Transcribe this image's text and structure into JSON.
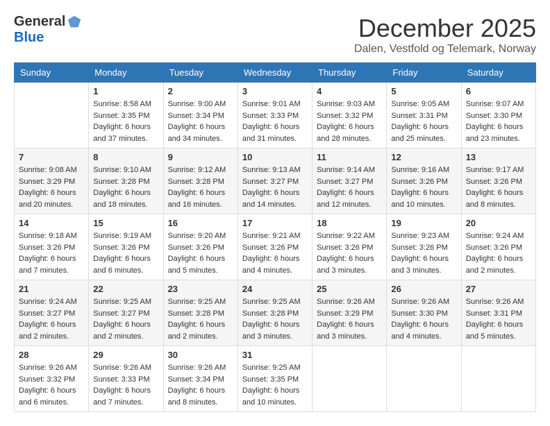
{
  "logo": {
    "general": "General",
    "blue": "Blue"
  },
  "title": "December 2025",
  "subtitle": "Dalen, Vestfold og Telemark, Norway",
  "headers": [
    "Sunday",
    "Monday",
    "Tuesday",
    "Wednesday",
    "Thursday",
    "Friday",
    "Saturday"
  ],
  "weeks": [
    [
      {
        "day": "",
        "info": ""
      },
      {
        "day": "1",
        "info": "Sunrise: 8:58 AM\nSunset: 3:35 PM\nDaylight: 6 hours\nand 37 minutes."
      },
      {
        "day": "2",
        "info": "Sunrise: 9:00 AM\nSunset: 3:34 PM\nDaylight: 6 hours\nand 34 minutes."
      },
      {
        "day": "3",
        "info": "Sunrise: 9:01 AM\nSunset: 3:33 PM\nDaylight: 6 hours\nand 31 minutes."
      },
      {
        "day": "4",
        "info": "Sunrise: 9:03 AM\nSunset: 3:32 PM\nDaylight: 6 hours\nand 28 minutes."
      },
      {
        "day": "5",
        "info": "Sunrise: 9:05 AM\nSunset: 3:31 PM\nDaylight: 6 hours\nand 25 minutes."
      },
      {
        "day": "6",
        "info": "Sunrise: 9:07 AM\nSunset: 3:30 PM\nDaylight: 6 hours\nand 23 minutes."
      }
    ],
    [
      {
        "day": "7",
        "info": "Sunrise: 9:08 AM\nSunset: 3:29 PM\nDaylight: 6 hours\nand 20 minutes."
      },
      {
        "day": "8",
        "info": "Sunrise: 9:10 AM\nSunset: 3:28 PM\nDaylight: 6 hours\nand 18 minutes."
      },
      {
        "day": "9",
        "info": "Sunrise: 9:12 AM\nSunset: 3:28 PM\nDaylight: 6 hours\nand 16 minutes."
      },
      {
        "day": "10",
        "info": "Sunrise: 9:13 AM\nSunset: 3:27 PM\nDaylight: 6 hours\nand 14 minutes."
      },
      {
        "day": "11",
        "info": "Sunrise: 9:14 AM\nSunset: 3:27 PM\nDaylight: 6 hours\nand 12 minutes."
      },
      {
        "day": "12",
        "info": "Sunrise: 9:16 AM\nSunset: 3:26 PM\nDaylight: 6 hours\nand 10 minutes."
      },
      {
        "day": "13",
        "info": "Sunrise: 9:17 AM\nSunset: 3:26 PM\nDaylight: 6 hours\nand 8 minutes."
      }
    ],
    [
      {
        "day": "14",
        "info": "Sunrise: 9:18 AM\nSunset: 3:26 PM\nDaylight: 6 hours\nand 7 minutes."
      },
      {
        "day": "15",
        "info": "Sunrise: 9:19 AM\nSunset: 3:26 PM\nDaylight: 6 hours\nand 6 minutes."
      },
      {
        "day": "16",
        "info": "Sunrise: 9:20 AM\nSunset: 3:26 PM\nDaylight: 6 hours\nand 5 minutes."
      },
      {
        "day": "17",
        "info": "Sunrise: 9:21 AM\nSunset: 3:26 PM\nDaylight: 6 hours\nand 4 minutes."
      },
      {
        "day": "18",
        "info": "Sunrise: 9:22 AM\nSunset: 3:26 PM\nDaylight: 6 hours\nand 3 minutes."
      },
      {
        "day": "19",
        "info": "Sunrise: 9:23 AM\nSunset: 3:26 PM\nDaylight: 6 hours\nand 3 minutes."
      },
      {
        "day": "20",
        "info": "Sunrise: 9:24 AM\nSunset: 3:26 PM\nDaylight: 6 hours\nand 2 minutes."
      }
    ],
    [
      {
        "day": "21",
        "info": "Sunrise: 9:24 AM\nSunset: 3:27 PM\nDaylight: 6 hours\nand 2 minutes."
      },
      {
        "day": "22",
        "info": "Sunrise: 9:25 AM\nSunset: 3:27 PM\nDaylight: 6 hours\nand 2 minutes."
      },
      {
        "day": "23",
        "info": "Sunrise: 9:25 AM\nSunset: 3:28 PM\nDaylight: 6 hours\nand 2 minutes."
      },
      {
        "day": "24",
        "info": "Sunrise: 9:25 AM\nSunset: 3:28 PM\nDaylight: 6 hours\nand 3 minutes."
      },
      {
        "day": "25",
        "info": "Sunrise: 9:26 AM\nSunset: 3:29 PM\nDaylight: 6 hours\nand 3 minutes."
      },
      {
        "day": "26",
        "info": "Sunrise: 9:26 AM\nSunset: 3:30 PM\nDaylight: 6 hours\nand 4 minutes."
      },
      {
        "day": "27",
        "info": "Sunrise: 9:26 AM\nSunset: 3:31 PM\nDaylight: 6 hours\nand 5 minutes."
      }
    ],
    [
      {
        "day": "28",
        "info": "Sunrise: 9:26 AM\nSunset: 3:32 PM\nDaylight: 6 hours\nand 6 minutes."
      },
      {
        "day": "29",
        "info": "Sunrise: 9:26 AM\nSunset: 3:33 PM\nDaylight: 6 hours\nand 7 minutes."
      },
      {
        "day": "30",
        "info": "Sunrise: 9:26 AM\nSunset: 3:34 PM\nDaylight: 6 hours\nand 8 minutes."
      },
      {
        "day": "31",
        "info": "Sunrise: 9:25 AM\nSunset: 3:35 PM\nDaylight: 6 hours\nand 10 minutes."
      },
      {
        "day": "",
        "info": ""
      },
      {
        "day": "",
        "info": ""
      },
      {
        "day": "",
        "info": ""
      }
    ]
  ]
}
